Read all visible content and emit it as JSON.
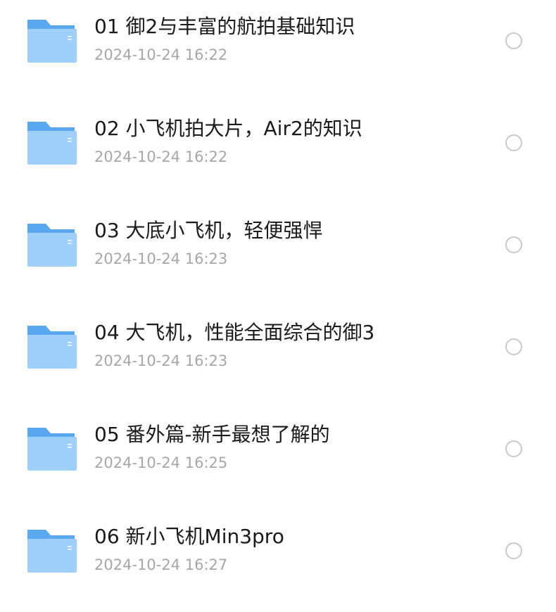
{
  "colors": {
    "folder_back": "#5aa8f0",
    "folder_front": "#9fd0fb",
    "title_text": "#1a1a1a",
    "date_text": "#a7a7a7",
    "radio_border": "#c9c9c9"
  },
  "files": [
    {
      "name": "01 御2与丰富的航拍基础知识",
      "date": "2024-10-24 16:22",
      "icon": "folder-icon",
      "selected": false
    },
    {
      "name": "02 小飞机拍大片，Air2的知识",
      "date": "2024-10-24 16:22",
      "icon": "folder-icon",
      "selected": false
    },
    {
      "name": "03 大底小飞机，轻便强悍",
      "date": "2024-10-24 16:23",
      "icon": "folder-icon",
      "selected": false
    },
    {
      "name": "04 大飞机，性能全面综合的御3",
      "date": "2024-10-24 16:23",
      "icon": "folder-icon",
      "selected": false
    },
    {
      "name": "05 番外篇-新手最想了解的",
      "date": "2024-10-24 16:25",
      "icon": "folder-icon",
      "selected": false
    },
    {
      "name": "06 新小飞机Min3pro",
      "date": "2024-10-24 16:27",
      "icon": "folder-icon",
      "selected": false
    }
  ]
}
